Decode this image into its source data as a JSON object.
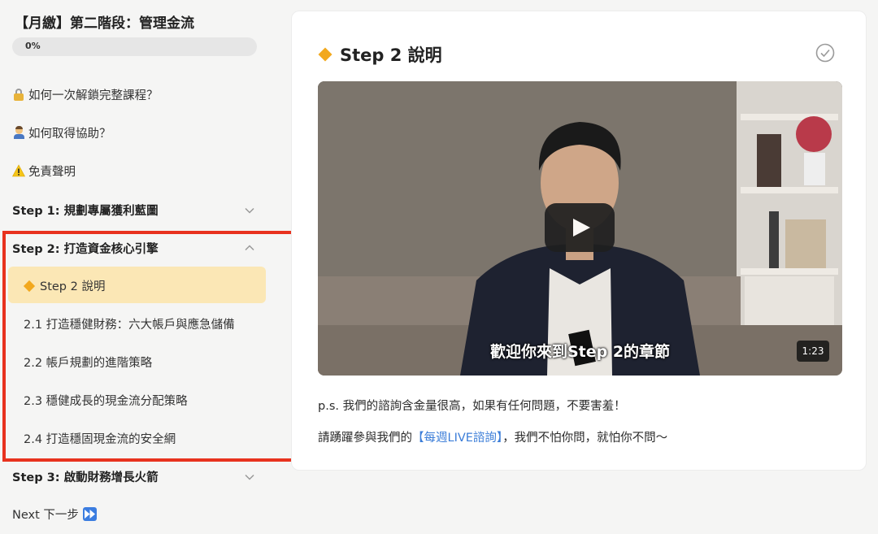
{
  "sidebar": {
    "course_title": "【月繳】第二階段：管理金流",
    "progress_text": "0%",
    "progress_value": 0,
    "links": [
      {
        "icon": "lock-icon",
        "label": "如何一次解鎖完整課程？"
      },
      {
        "icon": "person-raising-hand-icon",
        "label": "如何取得協助？"
      },
      {
        "icon": "warning-icon",
        "label": "免責聲明"
      }
    ],
    "step1": {
      "label": "Step 1: 規劃專屬獲利藍圖",
      "state": "collapsed"
    },
    "step2": {
      "label": "Step 2: 打造資金核心引擎",
      "state": "expanded",
      "lessons": [
        {
          "label": "Step 2 說明",
          "active": true
        },
        {
          "label": "2.1 打造穩健財務：六大帳戶與應急儲備",
          "active": false
        },
        {
          "label": "2.2 帳戶規劃的進階策略",
          "active": false
        },
        {
          "label": "2.3 穩健成長的現金流分配策略",
          "active": false
        },
        {
          "label": "2.4 打造穩固現金流的安全網",
          "active": false
        }
      ]
    },
    "step3": {
      "label": "Step 3: 啟動財務增長火箭",
      "state": "collapsed"
    },
    "next_label": "Next 下一步"
  },
  "main": {
    "title": "Step 2 說明",
    "video": {
      "subtitle": "歡迎你來到Step 2的章節",
      "duration": "1:23"
    },
    "line1": "p.s. 我們的諮詢含金量很高，如果有任何問題，不要害羞！",
    "line2_prefix": "請踴躍參與我們的",
    "line2_link": "【每週LIVE諮詢】",
    "line2_suffix": "，我們不怕你問，就怕你不問～"
  },
  "colors": {
    "highlight_border": "#e8321e",
    "active_bg": "#fbe7b5",
    "link": "#3b7dd8",
    "diamond": "#f2a81d"
  }
}
